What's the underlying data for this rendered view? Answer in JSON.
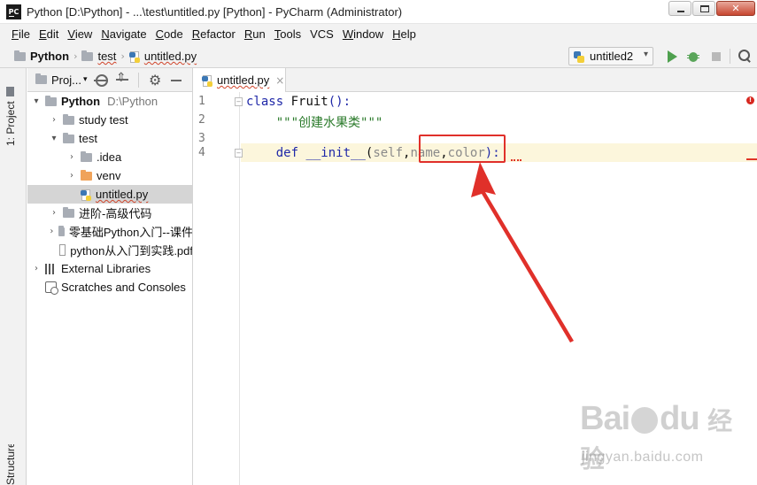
{
  "window": {
    "app_icon_text": "PC",
    "title": "Python [D:\\Python] - ...\\test\\untitled.py [Python] - PyCharm (Administrator)",
    "controls": {
      "minimize": "minimize",
      "maximize": "maximize",
      "close": "✕"
    }
  },
  "menu": [
    {
      "u": "F",
      "rest": "ile"
    },
    {
      "u": "E",
      "rest": "dit"
    },
    {
      "u": "V",
      "rest": "iew"
    },
    {
      "u": "N",
      "rest": "avigate"
    },
    {
      "u": "C",
      "rest": "ode"
    },
    {
      "u": "R",
      "rest": "efactor"
    },
    {
      "u": "R",
      "rest": "un"
    },
    {
      "u": "T",
      "rest": "ools"
    },
    {
      "u": "",
      "rest": "VCS"
    },
    {
      "u": "W",
      "rest": "indow"
    },
    {
      "u": "H",
      "rest": "elp"
    }
  ],
  "breadcrumb": {
    "root": "Python",
    "folder": "test",
    "file": "untitled.py"
  },
  "run_config": {
    "label": "untitled2",
    "dropdown": "▾"
  },
  "toolstrip": {
    "project_tab": "1: Project",
    "structure_tab": "Structure"
  },
  "project_panel": {
    "title": "Proj...",
    "dropdown": "▾"
  },
  "tree": [
    {
      "indent": 0,
      "arrow": "▾",
      "icon": "folder",
      "label": "Python",
      "path": "D:\\Python",
      "bold": true
    },
    {
      "indent": 1,
      "arrow": "›",
      "icon": "folder",
      "label": "study test"
    },
    {
      "indent": 1,
      "arrow": "▾",
      "icon": "folder",
      "label": "test"
    },
    {
      "indent": 2,
      "arrow": "›",
      "icon": "folder",
      "label": ".idea"
    },
    {
      "indent": 2,
      "arrow": "›",
      "icon": "folder-orange",
      "label": "venv"
    },
    {
      "indent": 2,
      "arrow": "",
      "icon": "pyfile",
      "label": "untitled.py",
      "selected": true,
      "squiggle": true
    },
    {
      "indent": 1,
      "arrow": "›",
      "icon": "folder",
      "label": "进阶-高级代码"
    },
    {
      "indent": 1,
      "arrow": "›",
      "icon": "folder",
      "label": "零基础Python入门--课件"
    },
    {
      "indent": 1,
      "arrow": "",
      "icon": "pdf",
      "label": "python从入门到实践.pdf"
    },
    {
      "indent": 0,
      "arrow": "›",
      "icon": "libs",
      "label": "External Libraries"
    },
    {
      "indent": 0,
      "arrow": "",
      "icon": "scratch",
      "label": "Scratches and Consoles"
    }
  ],
  "editor_tab": {
    "label": "untitled.py",
    "close": "×"
  },
  "code": {
    "line_numbers": [
      "1",
      "2",
      "3",
      "4"
    ],
    "line1": {
      "kw": "class",
      "name": " Fruit",
      "rest": "():"
    },
    "line2": {
      "quote_open": "    \"\"\"",
      "text": "创建水果类",
      "quote_close": "\"\"\""
    },
    "line4": {
      "indent": "    ",
      "kw": "def",
      "sp": " ",
      "fn": "__init__",
      "open": "(",
      "self": "self",
      "comma1": ",",
      "p1": "name",
      "comma2": ",",
      "p2": "color",
      "close": "):"
    }
  },
  "error_indicator": "!",
  "watermark": {
    "logo_a": "Bai",
    "logo_b": "du",
    "logo_cn": "经验",
    "url": "jingyan.baidu.com"
  },
  "annotation_color": "#e0302a"
}
